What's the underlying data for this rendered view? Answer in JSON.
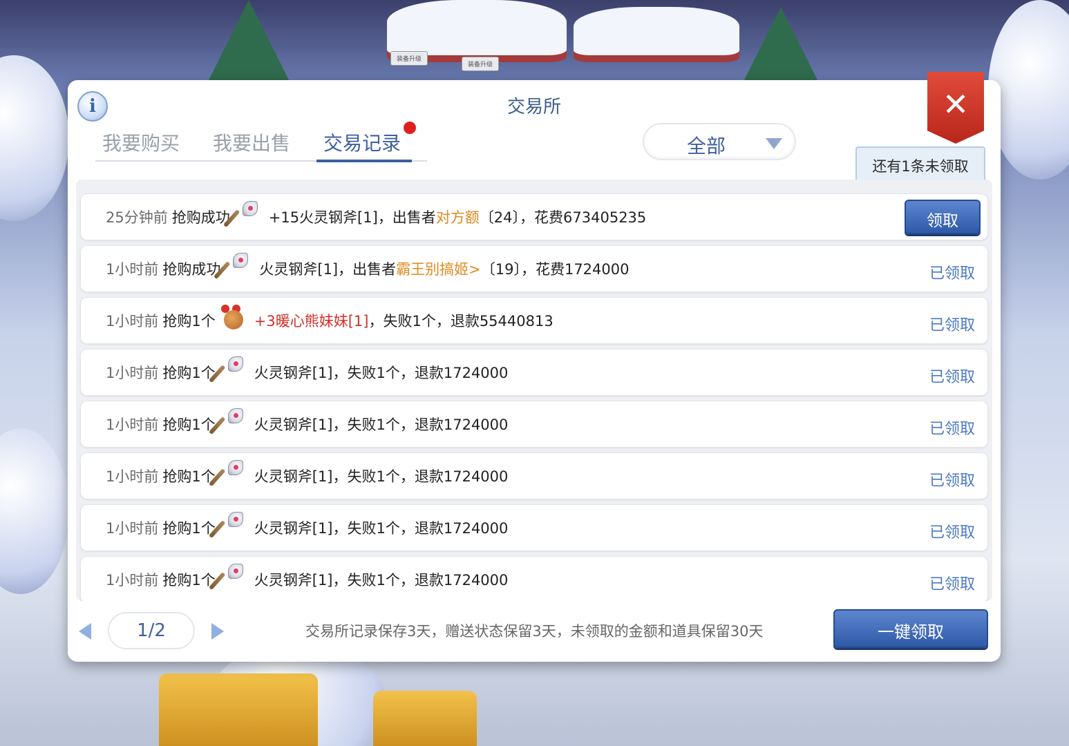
{
  "colors": {
    "accent": "#3e5fa0",
    "claimed": "#4a79c2",
    "seller": "#e08a1e",
    "item_red": "#d2302a",
    "close": "#c8301f"
  },
  "scene": {
    "sign1": "装备升级",
    "sign2": "装备升级"
  },
  "panel": {
    "title": "交易所",
    "info_icon": "i",
    "close_icon": "✕",
    "tabs": [
      {
        "label": "我要购买",
        "active": false
      },
      {
        "label": "我要出售",
        "active": false
      },
      {
        "label": "交易记录",
        "active": true,
        "badge": "red-dot"
      }
    ],
    "filter": {
      "selected": "全部"
    },
    "unclaimed_tip": "还有1条未领取"
  },
  "records": [
    {
      "time": "25分钟前",
      "action": "抢购成功",
      "icon": "axe-icon",
      "item": "+15火灵钢斧[1]",
      "mid": "，出售者",
      "seller": "对方额",
      "rest": "〔24〕，花费673405235",
      "status": "领取",
      "claimable": true
    },
    {
      "time": "1小时前",
      "action": "抢购成功",
      "icon": "axe-icon",
      "item": "火灵钢斧[1]",
      "mid": "，出售者",
      "seller": "霸王别搞姬>",
      "rest": "〔19〕，花费1724000",
      "status": "已领取",
      "claimable": false
    },
    {
      "time": "1小时前",
      "action": "抢购1个",
      "icon": "bear-icon",
      "item": "+3暖心熊妹妹[1]",
      "item_red": true,
      "mid": "",
      "seller": "",
      "rest": "，失败1个，退款55440813",
      "status": "已领取",
      "claimable": false
    },
    {
      "time": "1小时前",
      "action": "抢购1个",
      "icon": "axe-icon",
      "item": "火灵钢斧[1]",
      "mid": "",
      "seller": "",
      "rest": "，失败1个，退款1724000",
      "status": "已领取",
      "claimable": false
    },
    {
      "time": "1小时前",
      "action": "抢购1个",
      "icon": "axe-icon",
      "item": "火灵钢斧[1]",
      "mid": "",
      "seller": "",
      "rest": "，失败1个，退款1724000",
      "status": "已领取",
      "claimable": false
    },
    {
      "time": "1小时前",
      "action": "抢购1个",
      "icon": "axe-icon",
      "item": "火灵钢斧[1]",
      "mid": "",
      "seller": "",
      "rest": "，失败1个，退款1724000",
      "status": "已领取",
      "claimable": false
    },
    {
      "time": "1小时前",
      "action": "抢购1个",
      "icon": "axe-icon",
      "item": "火灵钢斧[1]",
      "mid": "",
      "seller": "",
      "rest": "，失败1个，退款1724000",
      "status": "已领取",
      "claimable": false
    },
    {
      "time": "1小时前",
      "action": "抢购1个",
      "icon": "axe-icon",
      "item": "火灵钢斧[1]",
      "mid": "",
      "seller": "",
      "rest": "，失败1个，退款1724000",
      "status": "已领取",
      "claimable": false
    }
  ],
  "footer": {
    "page": "1/2",
    "note": "交易所记录保存3天，赠送状态保留3天，未领取的金额和道具保留30天",
    "claim_all": "一键领取"
  }
}
